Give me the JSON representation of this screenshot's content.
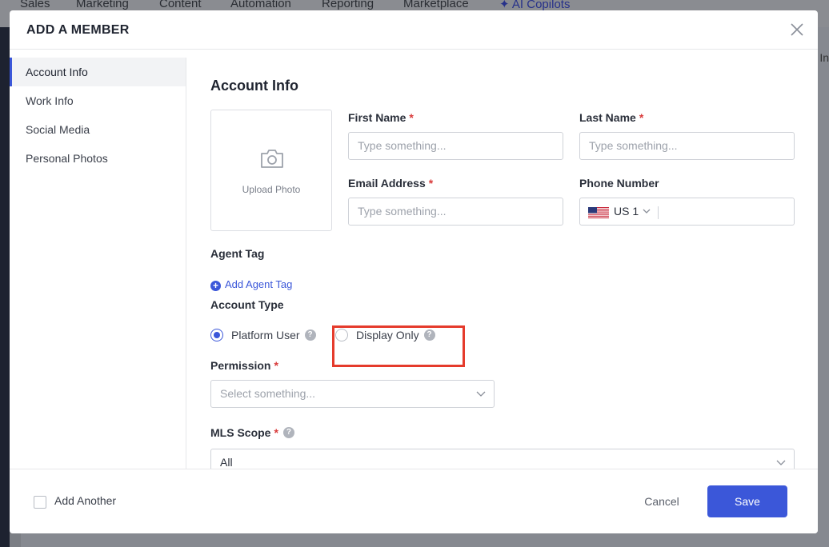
{
  "background": {
    "nav": [
      "Sales",
      "Marketing",
      "Content",
      "Automation",
      "Reporting",
      "Marketplace",
      "AI Copilots"
    ],
    "right_partial_text": "e In"
  },
  "modal": {
    "title": "ADD A MEMBER",
    "close_icon": "close-icon"
  },
  "sidebar": {
    "items": [
      {
        "label": "Account Info",
        "active": true
      },
      {
        "label": "Work Info",
        "active": false
      },
      {
        "label": "Social Media",
        "active": false
      },
      {
        "label": "Personal Photos",
        "active": false
      }
    ]
  },
  "form": {
    "section_title": "Account Info",
    "upload_label": "Upload Photo",
    "first_name": {
      "label": "First Name",
      "required": "*",
      "placeholder": "Type something..."
    },
    "last_name": {
      "label": "Last Name",
      "required": "*",
      "placeholder": "Type something..."
    },
    "email": {
      "label": "Email Address",
      "required": "*",
      "placeholder": "Type something..."
    },
    "phone": {
      "label": "Phone Number",
      "country_code": "US 1"
    },
    "agent_tag": {
      "label": "Agent Tag",
      "add_label": "Add Agent Tag"
    },
    "account_type": {
      "label": "Account Type",
      "options": [
        {
          "label": "Platform User",
          "selected": true
        },
        {
          "label": "Display Only",
          "selected": false
        }
      ]
    },
    "permission": {
      "label": "Permission",
      "required": "*",
      "placeholder": "Select something..."
    },
    "mls_scope": {
      "label": "MLS Scope",
      "required": "*",
      "value": "All"
    }
  },
  "footer": {
    "add_another_label": "Add Another",
    "cancel_label": "Cancel",
    "save_label": "Save"
  },
  "colors": {
    "accent": "#3b57d9",
    "required": "#d93a3a",
    "highlight": "#e53b2c"
  }
}
